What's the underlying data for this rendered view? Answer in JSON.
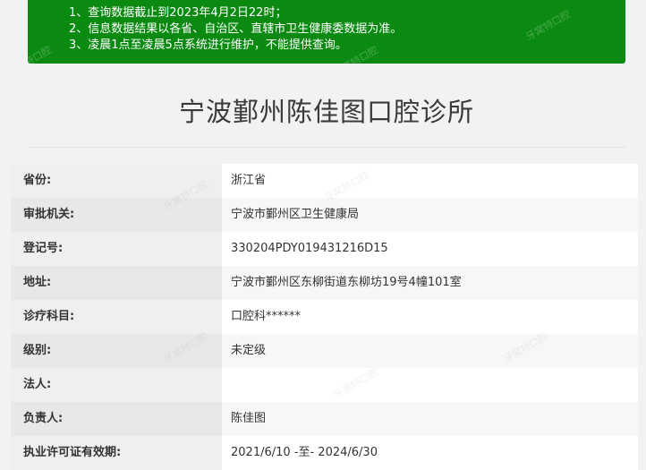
{
  "notice": {
    "lines": [
      "1、查询数据截止到2023年4月2日22时；",
      "2、信息数据结果以各省、自治区、直辖市卫生健康委数据为准。",
      "3、凌晨1点至凌晨5点系统进行维护，不能提供查询。"
    ]
  },
  "title": "宁波鄞州陈佳图口腔诊所",
  "rows": [
    {
      "label": "省份:",
      "value": "浙江省"
    },
    {
      "label": "审批机关:",
      "value": "宁波市鄞州区卫生健康局"
    },
    {
      "label": "登记号:",
      "value": "330204PDY019431216D15"
    },
    {
      "label": "地址:",
      "value": "宁波市鄞州区东柳街道东柳坊19号4幢101室"
    },
    {
      "label": "诊疗科目:",
      "value": "口腔科******"
    },
    {
      "label": "级别:",
      "value": "未定级"
    },
    {
      "label": "法人:",
      "value": ""
    },
    {
      "label": "负责人:",
      "value": "陈佳图"
    },
    {
      "label": "执业许可证有效期:",
      "value": "2021/6/10 -至- 2024/6/30"
    }
  ],
  "watermark": "牙窝特口腔"
}
